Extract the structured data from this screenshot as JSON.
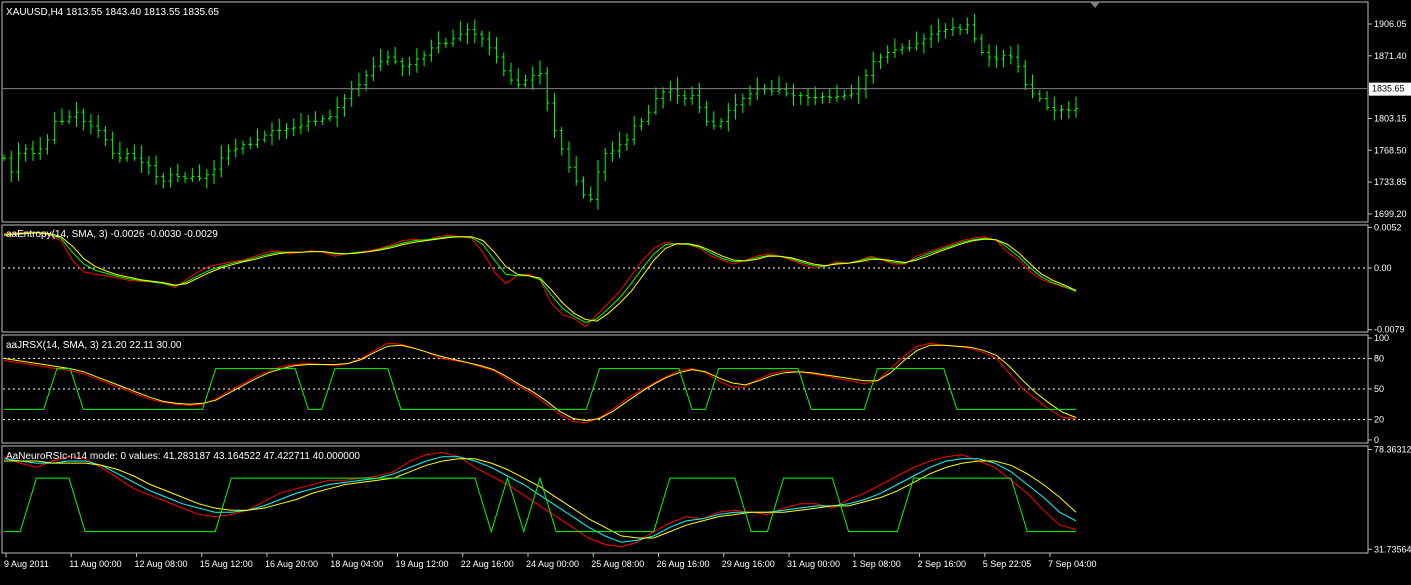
{
  "colors": {
    "background": "#000000",
    "frame": "#c0c0c0",
    "text": "#ffffff",
    "candle": "#00ff00",
    "red": "#ff0000",
    "yellow": "#ffff00",
    "green": "#00ff00",
    "cyan": "#00ffff",
    "price_line": "#808080",
    "level_line": "#ffffff"
  },
  "chart_data": [
    {
      "type": "bar",
      "id": "price",
      "title": "XAUUSD,H4  1813.55 1843.40 1813.55 1835.65",
      "ylim": [
        1690.43,
        1930.0
      ],
      "current_price": 1835.65,
      "current_price_label": "1835.65",
      "y_ticks": [
        "1906.05",
        "1871.40",
        "1803.15",
        "1768.50",
        "1733.85",
        "1699.20"
      ],
      "y_tick_values": [
        1906.05,
        1871.4,
        1803.15,
        1768.5,
        1733.85,
        1699.2
      ],
      "x_ticks": [
        "9 Aug 2011",
        "11 Aug 00:00",
        "12 Aug 08:00",
        "15 Aug 12:00",
        "16 Aug 20:00",
        "18 Aug 04:00",
        "19 Aug 12:00",
        "22 Aug 16:00",
        "24 Aug 00:00",
        "25 Aug 08:00",
        "26 Aug 16:00",
        "29 Aug 16:00",
        "31 Aug 00:00",
        "1 Sep 08:00",
        "2 Sep 16:00",
        "5 Sep 22:05",
        "7 Sep 04:00"
      ],
      "close_series": [
        1760,
        1745,
        1765,
        1770,
        1765,
        1770,
        1780,
        1800,
        1800,
        1805,
        1810,
        1800,
        1795,
        1790,
        1780,
        1765,
        1760,
        1765,
        1760,
        1755,
        1752,
        1740,
        1735,
        1742,
        1740,
        1738,
        1740,
        1738,
        1742,
        1748,
        1760,
        1768,
        1770,
        1775,
        1775,
        1780,
        1785,
        1790,
        1790,
        1792,
        1793,
        1795,
        1800,
        1800,
        1803,
        1805,
        1815,
        1825,
        1835,
        1840,
        1850,
        1860,
        1865,
        1870,
        1865,
        1860,
        1862,
        1868,
        1872,
        1880,
        1885,
        1885,
        1890,
        1895,
        1900,
        1895,
        1890,
        1880,
        1870,
        1855,
        1845,
        1840,
        1845,
        1850,
        1852,
        1820,
        1790,
        1770,
        1750,
        1735,
        1720,
        1715,
        1745,
        1765,
        1768,
        1775,
        1780,
        1795,
        1800,
        1810,
        1825,
        1832,
        1835,
        1828,
        1825,
        1828,
        1815,
        1800,
        1795,
        1800,
        1812,
        1818,
        1825,
        1830,
        1835,
        1835,
        1833,
        1835,
        1830,
        1828,
        1828,
        1826,
        1826,
        1827,
        1826,
        1827,
        1828,
        1830,
        1835,
        1850,
        1865,
        1870,
        1875,
        1878,
        1880,
        1880,
        1885,
        1890,
        1895,
        1898,
        1900,
        1902,
        1900,
        1905,
        1890,
        1875,
        1870,
        1868,
        1872,
        1870,
        1860,
        1840,
        1830,
        1825,
        1815,
        1812,
        1813,
        1812,
        1814
      ]
    },
    {
      "type": "line",
      "id": "entropy",
      "title": "aaEntropy(14, SMA, 3)  -0.0026 -0.0030 -0.0029",
      "ylim": [
        -0.0082,
        0.0055
      ],
      "y_ticks": [
        "0.0052",
        "0.00",
        "-0.0079"
      ],
      "y_tick_values": [
        0.0052,
        0.0,
        -0.0079
      ],
      "levels": [
        0.0
      ],
      "series": [
        {
          "color_key": "red",
          "values": [
            0.0044,
            0.0045,
            0.0046,
            0.0045,
            0.0042,
            0.0035,
            0.001,
            -0.0005,
            -0.0008,
            -0.001,
            -0.0013,
            -0.0016,
            -0.0017,
            -0.0018,
            -0.002,
            -0.0025,
            -0.0015,
            -0.0005,
            0.0002,
            0.0005,
            0.0008,
            0.001,
            0.0015,
            0.002,
            0.0022,
            0.0018,
            0.002,
            0.0022,
            0.002,
            0.0015,
            0.0018,
            0.002,
            0.0022,
            0.0025,
            0.003,
            0.0035,
            0.0037,
            0.0035,
            0.004,
            0.0042,
            0.004,
            0.0038,
            0.002,
            -0.0005,
            -0.002,
            -0.001,
            -0.0008,
            -0.0015,
            -0.0045,
            -0.006,
            -0.0065,
            -0.0075,
            -0.006,
            -0.0045,
            -0.003,
            -0.001,
            0.001,
            0.0025,
            0.0033,
            0.003,
            0.003,
            0.0025,
            0.0015,
            0.001,
            0.0005,
            0.001,
            0.0015,
            0.0018,
            0.0015,
            0.001,
            0.0005,
            0.0,
            0.0002,
            0.0008,
            0.0006,
            0.001,
            0.0015,
            0.001,
            0.0005,
            0.0005,
            0.0015,
            0.002,
            0.0025,
            0.003,
            0.0035,
            0.0038,
            0.004,
            0.0035,
            0.002,
            0.001,
            -0.0005,
            -0.0015,
            -0.002,
            -0.0025,
            -0.0028
          ]
        },
        {
          "color_key": "green",
          "values": [
            0.0043,
            0.0044,
            0.0045,
            0.0045,
            0.0043,
            0.0038,
            0.002,
            0.0005,
            -0.0003,
            -0.0007,
            -0.0011,
            -0.0014,
            -0.0016,
            -0.0018,
            -0.002,
            -0.0023,
            -0.0018,
            -0.001,
            -0.0003,
            0.0002,
            0.0006,
            0.0009,
            0.0013,
            0.0017,
            0.002,
            0.002,
            0.002,
            0.0021,
            0.0021,
            0.0018,
            0.0018,
            0.002,
            0.0021,
            0.0024,
            0.0028,
            0.0032,
            0.0035,
            0.0036,
            0.0038,
            0.004,
            0.004,
            0.0039,
            0.003,
            0.001,
            -0.0008,
            -0.001,
            -0.001,
            -0.0015,
            -0.0035,
            -0.0052,
            -0.0062,
            -0.007,
            -0.0065,
            -0.0052,
            -0.0038,
            -0.002,
            0.0,
            0.0018,
            0.003,
            0.0031,
            0.003,
            0.0027,
            0.0019,
            0.0012,
            0.0008,
            0.0009,
            0.0013,
            0.0016,
            0.0015,
            0.0012,
            0.0007,
            0.0003,
            0.0002,
            0.0006,
            0.0006,
            0.0009,
            0.0013,
            0.0011,
            0.0007,
            0.0006,
            0.0012,
            0.0018,
            0.0023,
            0.0028,
            0.0033,
            0.0036,
            0.0038,
            0.0036,
            0.0026,
            0.0014,
            0.0,
            -0.0012,
            -0.0019,
            -0.0024,
            -0.003
          ]
        },
        {
          "color_key": "yellow",
          "values": [
            0.0042,
            0.0043,
            0.0044,
            0.0045,
            0.0044,
            0.004,
            0.0028,
            0.0012,
            0.0002,
            -0.0004,
            -0.0009,
            -0.0012,
            -0.0015,
            -0.0017,
            -0.0019,
            -0.0022,
            -0.002,
            -0.0013,
            -0.0006,
            0.0,
            0.0004,
            0.0008,
            0.0011,
            0.0015,
            0.0018,
            0.002,
            0.002,
            0.0021,
            0.0021,
            0.0019,
            0.0018,
            0.0019,
            0.0021,
            0.0023,
            0.0026,
            0.003,
            0.0033,
            0.0035,
            0.0037,
            0.0039,
            0.004,
            0.004,
            0.0035,
            0.002,
            0.0002,
            -0.0008,
            -0.001,
            -0.0013,
            -0.0028,
            -0.0045,
            -0.0058,
            -0.0066,
            -0.0068,
            -0.0058,
            -0.0045,
            -0.003,
            -0.001,
            0.001,
            0.0025,
            0.0031,
            0.0031,
            0.0028,
            0.0022,
            0.0015,
            0.001,
            0.0009,
            0.0011,
            0.0015,
            0.0015,
            0.0013,
            0.0009,
            0.0005,
            0.0003,
            0.0005,
            0.0006,
            0.0008,
            0.0011,
            0.0011,
            0.0009,
            0.0007,
            0.001,
            0.0015,
            0.0021,
            0.0026,
            0.0031,
            0.0035,
            0.0037,
            0.0036,
            0.003,
            0.0019,
            0.0005,
            -0.0008,
            -0.0016,
            -0.0022,
            -0.0029
          ]
        }
      ]
    },
    {
      "type": "line",
      "id": "jrsx",
      "title": "aaJRSX(14, SMA, 3)  21.20 22.11 30.00",
      "ylim": [
        -3,
        103
      ],
      "y_ticks": [
        "100",
        "80",
        "50",
        "20",
        "0"
      ],
      "y_tick_values": [
        100,
        80,
        50,
        20,
        0
      ],
      "levels": [
        80,
        50,
        20
      ],
      "series": [
        {
          "color_key": "red",
          "values": [
            78,
            76,
            74,
            72,
            70,
            68,
            65,
            60,
            55,
            50,
            45,
            40,
            37,
            35,
            34,
            35,
            40,
            48,
            55,
            62,
            68,
            72,
            74,
            75,
            74,
            73,
            75,
            80,
            88,
            95,
            94,
            90,
            86,
            80,
            78,
            76,
            72,
            68,
            60,
            52,
            45,
            35,
            25,
            18,
            17,
            22,
            30,
            40,
            48,
            55,
            62,
            68,
            70,
            66,
            58,
            52,
            52,
            60,
            65,
            68,
            67,
            65,
            63,
            60,
            58,
            55,
            58,
            70,
            82,
            92,
            95,
            93,
            92,
            90,
            86,
            80,
            65,
            50,
            40,
            30,
            22,
            21
          ]
        },
        {
          "color_key": "yellow",
          "values": [
            80,
            78,
            76,
            74,
            72,
            70,
            67,
            62,
            57,
            52,
            47,
            42,
            38,
            36,
            35,
            36,
            39,
            46,
            53,
            60,
            66,
            70,
            73,
            74,
            74,
            74,
            75,
            79,
            86,
            92,
            93,
            90,
            86,
            82,
            79,
            76,
            73,
            69,
            62,
            54,
            47,
            38,
            28,
            21,
            19,
            21,
            28,
            37,
            46,
            54,
            61,
            66,
            69,
            67,
            61,
            56,
            54,
            58,
            63,
            66,
            67,
            66,
            64,
            62,
            60,
            58,
            58,
            66,
            78,
            88,
            93,
            93,
            92,
            91,
            88,
            83,
            72,
            58,
            46,
            36,
            27,
            22
          ]
        },
        {
          "color_key": "green",
          "values": [
            30,
            30,
            30,
            30,
            70,
            70,
            30,
            30,
            30,
            30,
            30,
            30,
            30,
            30,
            30,
            30,
            70,
            70,
            70,
            70,
            70,
            70,
            70,
            30,
            30,
            70,
            70,
            70,
            70,
            70,
            30,
            30,
            30,
            30,
            30,
            30,
            30,
            30,
            30,
            30,
            30,
            30,
            30,
            30,
            30,
            70,
            70,
            70,
            70,
            70,
            70,
            70,
            30,
            30,
            70,
            70,
            70,
            70,
            70,
            70,
            70,
            30,
            30,
            30,
            30,
            30,
            70,
            70,
            70,
            70,
            70,
            70,
            30,
            30,
            30,
            30,
            30,
            30,
            30,
            30,
            30,
            30
          ]
        }
      ]
    },
    {
      "type": "line",
      "id": "neurorsi",
      "title": "AaNeuroRSIc-n14 mode: 0 values:  41.283187 43.164522 47.422711 40.000000",
      "ylim": [
        30.0,
        80.0
      ],
      "y_ticks": [
        "78.36312",
        "31.73564"
      ],
      "y_tick_values": [
        78.36312,
        31.73564
      ],
      "series": [
        {
          "color_key": "red",
          "values": [
            75,
            72,
            70,
            73,
            75,
            74,
            70,
            65,
            60,
            57,
            54,
            51,
            48,
            47,
            48,
            50,
            54,
            58,
            60,
            62,
            64,
            64,
            65,
            66,
            68,
            73,
            76,
            77,
            75,
            70,
            66,
            62,
            57,
            52,
            47,
            42,
            37,
            34,
            33,
            35,
            40,
            44,
            47,
            46,
            49,
            50,
            49,
            48,
            51,
            53,
            53,
            51,
            55,
            58,
            62,
            66,
            70,
            73,
            75,
            76,
            73,
            70,
            64,
            58,
            50,
            43,
            41
          ]
        },
        {
          "color_key": "cyan",
          "values": [
            74,
            73,
            72,
            72,
            73,
            73,
            71,
            67,
            63,
            59,
            56,
            53,
            51,
            49,
            49,
            50,
            52,
            55,
            58,
            60,
            62,
            63,
            64,
            65,
            67,
            70,
            73,
            75,
            75,
            73,
            70,
            66,
            62,
            57,
            52,
            47,
            42,
            38,
            35,
            36,
            38,
            42,
            45,
            46,
            48,
            49,
            49,
            49,
            50,
            51,
            52,
            52,
            53,
            55,
            58,
            62,
            66,
            70,
            73,
            74,
            74,
            72,
            68,
            62,
            56,
            49,
            45
          ]
        },
        {
          "color_key": "yellow",
          "values": [
            73,
            73,
            73,
            72,
            72,
            72,
            71,
            69,
            66,
            62,
            59,
            56,
            53,
            51,
            50,
            50,
            51,
            53,
            55,
            58,
            60,
            62,
            63,
            64,
            65,
            68,
            71,
            73,
            74,
            74,
            72,
            69,
            65,
            61,
            56,
            51,
            46,
            42,
            38,
            37,
            37,
            40,
            43,
            45,
            47,
            48,
            49,
            49,
            49,
            50,
            51,
            52,
            52,
            54,
            56,
            59,
            63,
            67,
            70,
            72,
            73,
            73,
            71,
            67,
            62,
            56,
            49
          ]
        },
        {
          "color_key": "green",
          "values": [
            40,
            40,
            65,
            65,
            65,
            40,
            40,
            40,
            40,
            40,
            40,
            40,
            40,
            40,
            65,
            65,
            65,
            65,
            65,
            65,
            65,
            65,
            65,
            65,
            65,
            65,
            65,
            65,
            65,
            65,
            40,
            65,
            40,
            65,
            40,
            40,
            40,
            40,
            40,
            40,
            40,
            65,
            65,
            65,
            65,
            65,
            40,
            40,
            65,
            65,
            65,
            65,
            40,
            40,
            40,
            40,
            65,
            65,
            65,
            65,
            65,
            65,
            65,
            40,
            40,
            40,
            40
          ]
        }
      ]
    }
  ]
}
